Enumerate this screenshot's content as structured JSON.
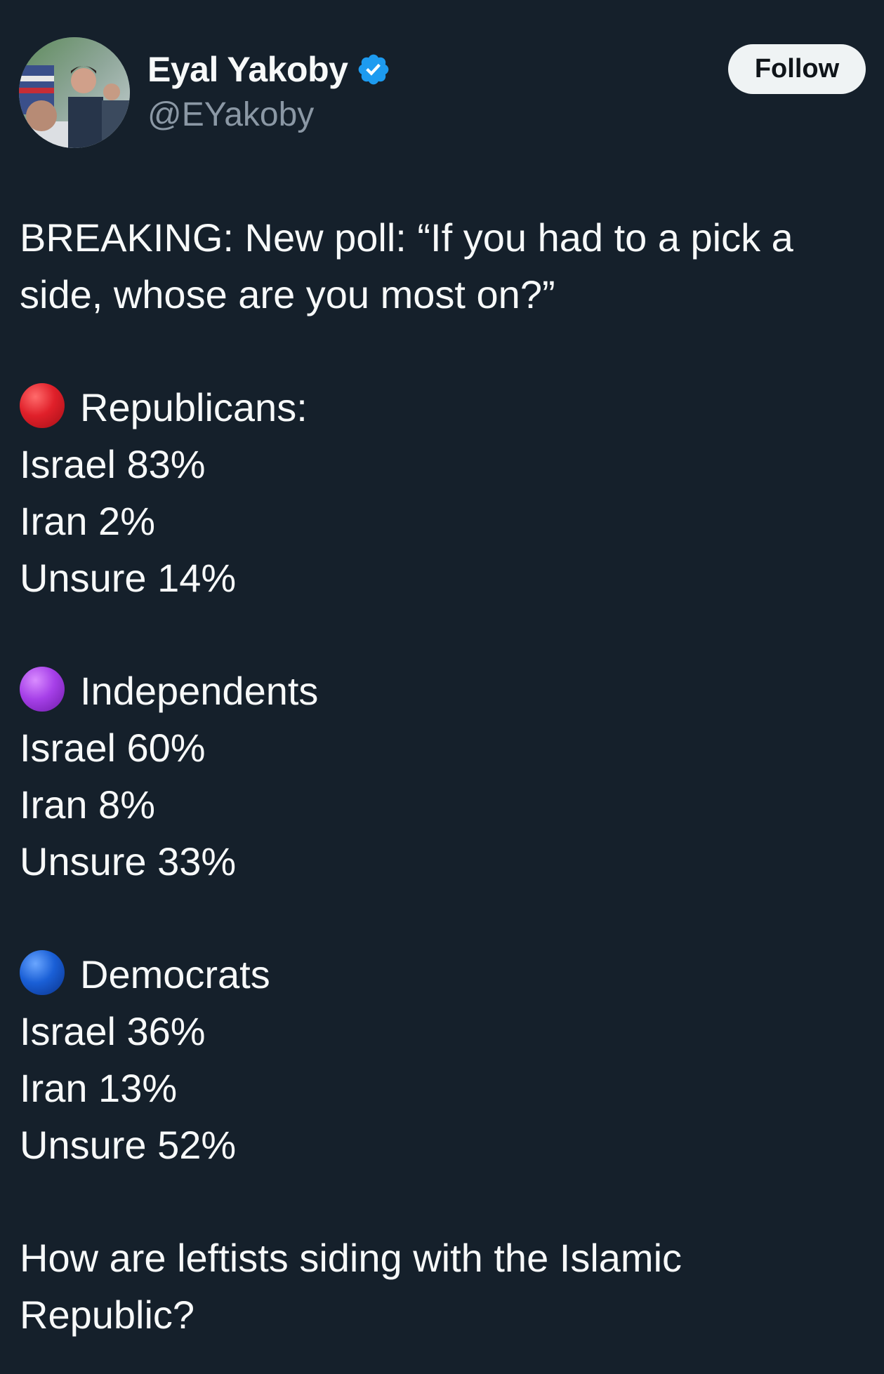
{
  "author": {
    "display_name": "Eyal Yakoby",
    "handle": "@EYakoby",
    "verified_badge_color": "#1d9bf0"
  },
  "actions": {
    "follow_label": "Follow"
  },
  "post": {
    "intro_line1": "BREAKING: New poll: “If you had to a pick a",
    "intro_line2": "side, whose are you most on?”",
    "groups": [
      {
        "emoji_color": "#e0202a",
        "label": "Republicans:",
        "lines": [
          "Israel 83%",
          "Iran 2%",
          "Unsure 14%"
        ]
      },
      {
        "emoji_color": "#a640e8",
        "label": "Independents",
        "lines": [
          "Israel 60%",
          "Iran 8%",
          "Unsure 33%"
        ]
      },
      {
        "emoji_color": "#1a5fd6",
        "label": "Democrats",
        "lines": [
          "Israel 36%",
          "Iran 13%",
          "Unsure 52%"
        ]
      }
    ],
    "closing_line1": "How are leftists siding with the Islamic",
    "closing_line2": "Republic?"
  },
  "colors": {
    "background": "#15202b",
    "text": "#f7f9f9",
    "secondary_text": "#8b98a5",
    "follow_button_bg": "#eff3f4"
  }
}
